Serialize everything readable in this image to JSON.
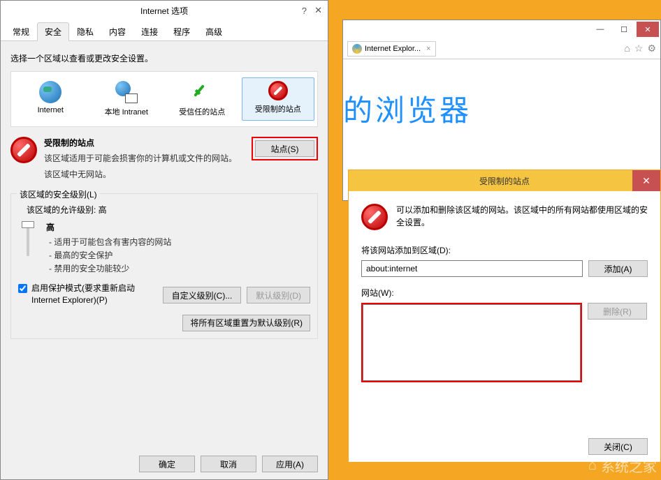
{
  "options": {
    "title": "Internet 选项",
    "tabs": [
      "常规",
      "安全",
      "隐私",
      "内容",
      "连接",
      "程序",
      "高级"
    ],
    "active_tab": 1,
    "instruction": "选择一个区域以查看或更改安全设置。",
    "zones": [
      {
        "label": "Internet"
      },
      {
        "label": "本地 Intranet"
      },
      {
        "label": "受信任的站点"
      },
      {
        "label": "受限制的站点"
      }
    ],
    "selected_zone": 3,
    "zone_detail": {
      "name": "受限制的站点",
      "desc1": "该区域适用于可能会损害你的计算机或文件的网站。",
      "desc2": "该区域中无网站。",
      "sites_btn": "站点(S)"
    },
    "level_group": {
      "legend": "该区域的安全级别(L)",
      "allowed": "该区域的允许级别: 高",
      "level_name": "高",
      "bullets": [
        "- 适用于可能包含有害内容的网站",
        "- 最高的安全保护",
        "- 禁用的安全功能较少"
      ],
      "protect_label": "启用保护模式(要求重新启动 Internet Explorer)(P)",
      "custom_btn": "自定义级别(C)...",
      "default_btn": "默认级别(D)",
      "reset_btn": "将所有区域重置为默认级别(R)"
    },
    "bottom": {
      "ok": "确定",
      "cancel": "取消",
      "apply": "应用(A)"
    }
  },
  "ie": {
    "tab_label": "Internet Explor...",
    "content_text": "的浏览器"
  },
  "restricted": {
    "title": "受限制的站点",
    "desc": "可以添加和删除该区域的网站。该区域中的所有网站都使用区域的安全设置。",
    "add_label": "将该网站添加到区域(D):",
    "input_value": "about:internet",
    "add_btn": "添加(A)",
    "list_label": "网站(W):",
    "remove_btn": "删除(R)",
    "close_btn": "关闭(C)"
  },
  "watermark": "系统之家"
}
